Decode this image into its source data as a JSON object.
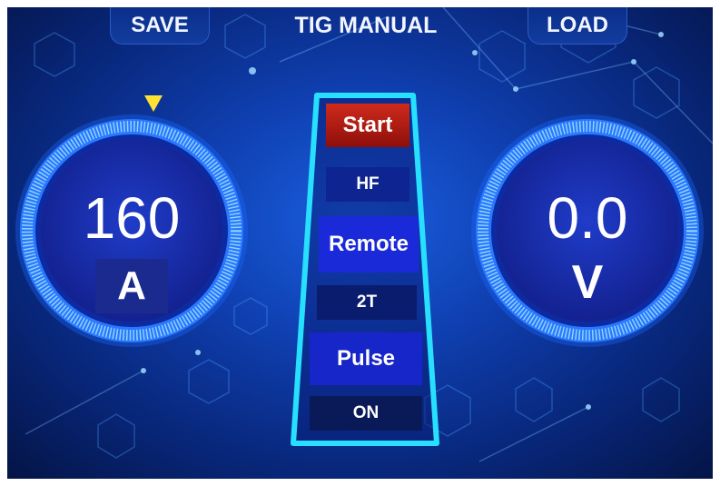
{
  "header": {
    "save_label": "SAVE",
    "title": "TIG MANUAL",
    "load_label": "LOAD"
  },
  "current_gauge": {
    "value": "160",
    "unit": "A"
  },
  "voltage_gauge": {
    "value": "0.0",
    "unit": "V"
  },
  "mode_panel": {
    "start_label": "Start",
    "start_value": "HF",
    "remote_label": "Remote",
    "remote_value": "2T",
    "pulse_label": "Pulse",
    "pulse_value": "ON"
  },
  "colors": {
    "background": "#0f3fb0",
    "gauge_ring": "#2a78ff",
    "panel_border": "#27e0ff",
    "start_red": "#b3160f",
    "pointer_yellow": "#ffe233"
  },
  "icons": {
    "pointer": "triangle-down-icon"
  }
}
